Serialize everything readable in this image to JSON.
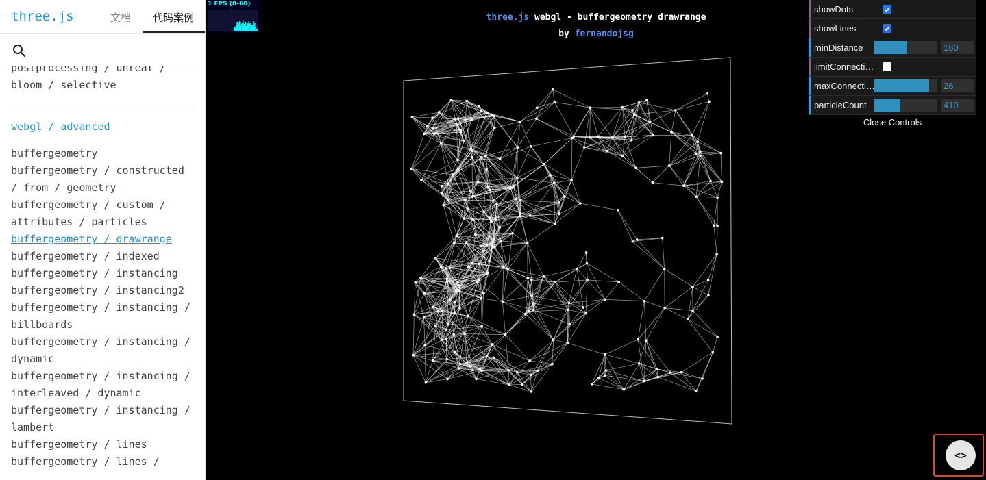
{
  "sidebar": {
    "logo": "three.js",
    "tabs": [
      {
        "label": "文档"
      },
      {
        "label": "代码案例"
      }
    ],
    "search_placeholder": "",
    "pre_items": [
      "postprocessing / unreal /\nbloom / selective"
    ],
    "category": "webgl / advanced",
    "items": [
      "buffergeometry",
      "buffergeometry / constructed\n/ from / geometry",
      "buffergeometry / custom /\nattributes / particles",
      "buffergeometry / drawrange",
      "buffergeometry / indexed",
      "buffergeometry / instancing",
      "buffergeometry / instancing2",
      "buffergeometry / instancing /\nbillboards",
      "buffergeometry / instancing /\ndynamic",
      "buffergeometry / instancing /\ninterleaved / dynamic",
      "buffergeometry / instancing /\nlambert",
      "buffergeometry / lines",
      "buffergeometry / lines /"
    ],
    "selected_index": 3
  },
  "stats": {
    "label": "1 FPS (0-60)"
  },
  "info": {
    "line1_link": "three.js",
    "line1_text": "webgl - buffergeometry drawrange",
    "line2_prefix": "by",
    "line2_link": "fernandojsg"
  },
  "gui": {
    "controls": [
      {
        "label": "showDots",
        "type": "checkbox",
        "checked": true
      },
      {
        "label": "showLines",
        "type": "checkbox",
        "checked": true
      },
      {
        "label": "minDistance",
        "type": "number",
        "value": "160",
        "fraction": 0.52
      },
      {
        "label": "limitConnecti…",
        "type": "checkbox",
        "checked": false
      },
      {
        "label": "maxConnecti…",
        "type": "number",
        "value": "26",
        "fraction": 0.87
      },
      {
        "label": "particleCount",
        "type": "number",
        "value": "410",
        "fraction": 0.41
      }
    ],
    "close_label": "Close Controls"
  },
  "code_button": {
    "icon": "<>"
  },
  "colors": {
    "accent": "#2194ce",
    "gui_number": "#2fa1d6",
    "gui_bool": "#806787",
    "highlight": "#e0452e"
  }
}
